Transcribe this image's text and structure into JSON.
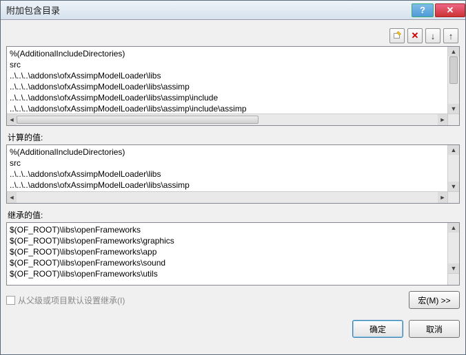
{
  "title": "附加包含目录",
  "toolbar": {
    "new_tip": "new-line",
    "del_tip": "delete-line",
    "down_tip": "move-down",
    "up_tip": "move-up"
  },
  "edit_lines": [
    "%(AdditionalIncludeDirectories)",
    "src",
    "..\\..\\..\\addons\\ofxAssimpModelLoader\\libs",
    "..\\..\\..\\addons\\ofxAssimpModelLoader\\libs\\assimp",
    "..\\..\\..\\addons\\ofxAssimpModelLoader\\libs\\assimp\\include",
    "..\\..\\..\\addons\\ofxAssimpModelLoader\\libs\\assimp\\include\\assimp"
  ],
  "computed_label": "计算的值:",
  "computed_lines": [
    "%(AdditionalIncludeDirectories)",
    "src",
    "..\\..\\..\\addons\\ofxAssimpModelLoader\\libs",
    "..\\..\\..\\addons\\ofxAssimpModelLoader\\libs\\assimp"
  ],
  "inherited_label": "继承的值:",
  "inherited_lines": [
    "$(OF_ROOT)\\libs\\openFrameworks",
    "$(OF_ROOT)\\libs\\openFrameworks\\graphics",
    "$(OF_ROOT)\\libs\\openFrameworks\\app",
    "$(OF_ROOT)\\libs\\openFrameworks\\sound",
    "$(OF_ROOT)\\libs\\openFrameworks\\utils"
  ],
  "inherit_checkbox_label": "从父级或项目默认设置继承(I)",
  "macros_btn": "宏(M) >>",
  "ok_btn": "确定",
  "cancel_btn": "取消"
}
